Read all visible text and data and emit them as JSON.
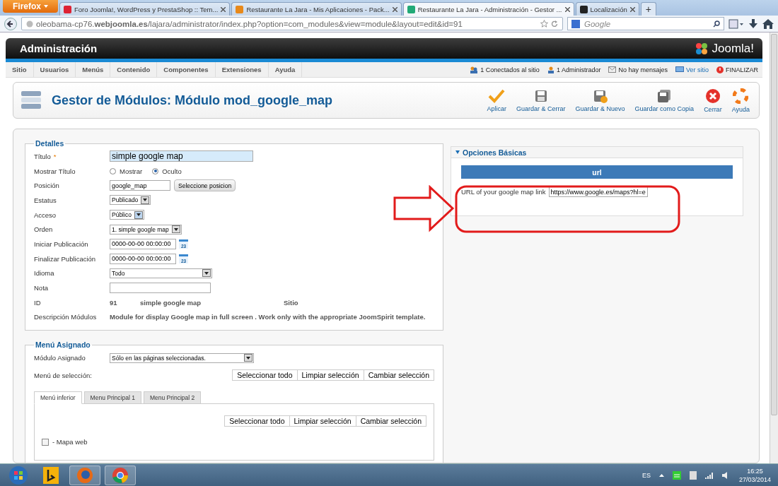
{
  "browser": {
    "menu_button": "Firefox",
    "tabs": [
      {
        "label": "Foro Joomla!, WordPress y PrestaShop :: Tem...",
        "selected": false
      },
      {
        "label": "Restaurante La Jara - Mis Aplicaciones - Pack...",
        "selected": false
      },
      {
        "label": "Restaurante La Jara - Administración - Gestor ...",
        "selected": true
      },
      {
        "label": "Localización",
        "selected": false
      }
    ],
    "new_tab": "+",
    "address": "oleobama-cp76.**webjoomla.es**/lajara/administrator/index.php?option=com_modules&view=module&layout=edit&id=91",
    "search": {
      "placeholder": "Google"
    }
  },
  "header": {
    "title": "Administración",
    "logo": "Joomla!"
  },
  "menu": {
    "items": [
      "Sitio",
      "Usuarios",
      "Menús",
      "Contenido",
      "Componentes",
      "Extensiones",
      "Ayuda"
    ],
    "status": [
      {
        "text": "1 Conectados al sitio",
        "kind": "users"
      },
      {
        "text": "1 Administrador",
        "kind": "user"
      },
      {
        "text": "No hay mensajes",
        "kind": "mail"
      },
      {
        "text": "Ver sitio",
        "kind": "link"
      },
      {
        "text": "FINALIZAR",
        "kind": "logout"
      }
    ]
  },
  "toolbar": {
    "title": "Gestor de Módulos: Módulo mod_google_map",
    "buttons": [
      {
        "label": "Aplicar",
        "kind": "apply"
      },
      {
        "label": "Guardar & Cerrar",
        "kind": "save"
      },
      {
        "label": "Guardar & Nuevo",
        "kind": "save-new"
      },
      {
        "label": "Guardar como Copia",
        "kind": "copy"
      },
      {
        "label": "Cerrar",
        "kind": "close"
      },
      {
        "label": "Ayuda",
        "kind": "help"
      }
    ]
  },
  "details": {
    "legend": "Detalles",
    "fields": [
      {
        "label": "Título",
        "required": "*",
        "kind": "title",
        "value": "simple google map"
      },
      {
        "label": "Mostrar Título",
        "kind": "radio",
        "options": [
          {
            "label": "Mostrar",
            "selected": false
          },
          {
            "label": "Oculto",
            "selected": true
          }
        ]
      },
      {
        "label": "Posición",
        "kind": "position",
        "value": "google_map",
        "button": "Seleccione posicion"
      },
      {
        "label": "Estatus",
        "kind": "select",
        "value": "Publicado"
      },
      {
        "label": "Acceso",
        "kind": "select",
        "value": "Público"
      },
      {
        "label": "Orden",
        "kind": "select",
        "value": "1. simple google map"
      },
      {
        "label": "Iniciar Publicación",
        "kind": "date",
        "value": "0000-00-00 00:00:00",
        "calendar": "23"
      },
      {
        "label": "Finalizar Publicación",
        "kind": "date",
        "value": "0000-00-00 00:00:00",
        "calendar": "23"
      },
      {
        "label": "Idioma",
        "kind": "wide-select",
        "value": "Todo"
      },
      {
        "label": "Nota",
        "kind": "text"
      },
      {
        "label": "ID",
        "kind": "info",
        "values": [
          "91",
          "simple google map",
          "Sitio"
        ]
      },
      {
        "label": "Descripción Módulos",
        "kind": "description",
        "value": "Module for display Google map in full screen . Work only with the appropriate JoomSpirit template."
      }
    ]
  },
  "basic_options": {
    "heading": "Opciones Básicas",
    "expanded": true,
    "section": "url",
    "field": {
      "label": "URL of your google map link",
      "value": "https://www.google.es/maps?hl=e"
    }
  },
  "menu_assigned": {
    "legend": "Menú Asignado",
    "module_label": "Módulo Asignado",
    "module_value": "Sólo en las páginas seleccionadas.",
    "selection_label": "Menú de selección:",
    "buttons": [
      "Seleccionar todo",
      "Limpiar selección",
      "Cambiar selección"
    ],
    "tabs": [
      {
        "label": "Menú inferior",
        "selected": true
      },
      {
        "label": "Menu Principal 1",
        "selected": false
      },
      {
        "label": "Menu Principal 2",
        "selected": false
      }
    ],
    "tab_buttons": [
      "Seleccionar todo",
      "Limpiar selección",
      "Cambiar selección"
    ],
    "items": [
      {
        "label": "- Mapa web",
        "checked": false
      }
    ]
  },
  "taskbar": {
    "language": "ES",
    "time": "16:25",
    "date": "27/03/2014"
  }
}
